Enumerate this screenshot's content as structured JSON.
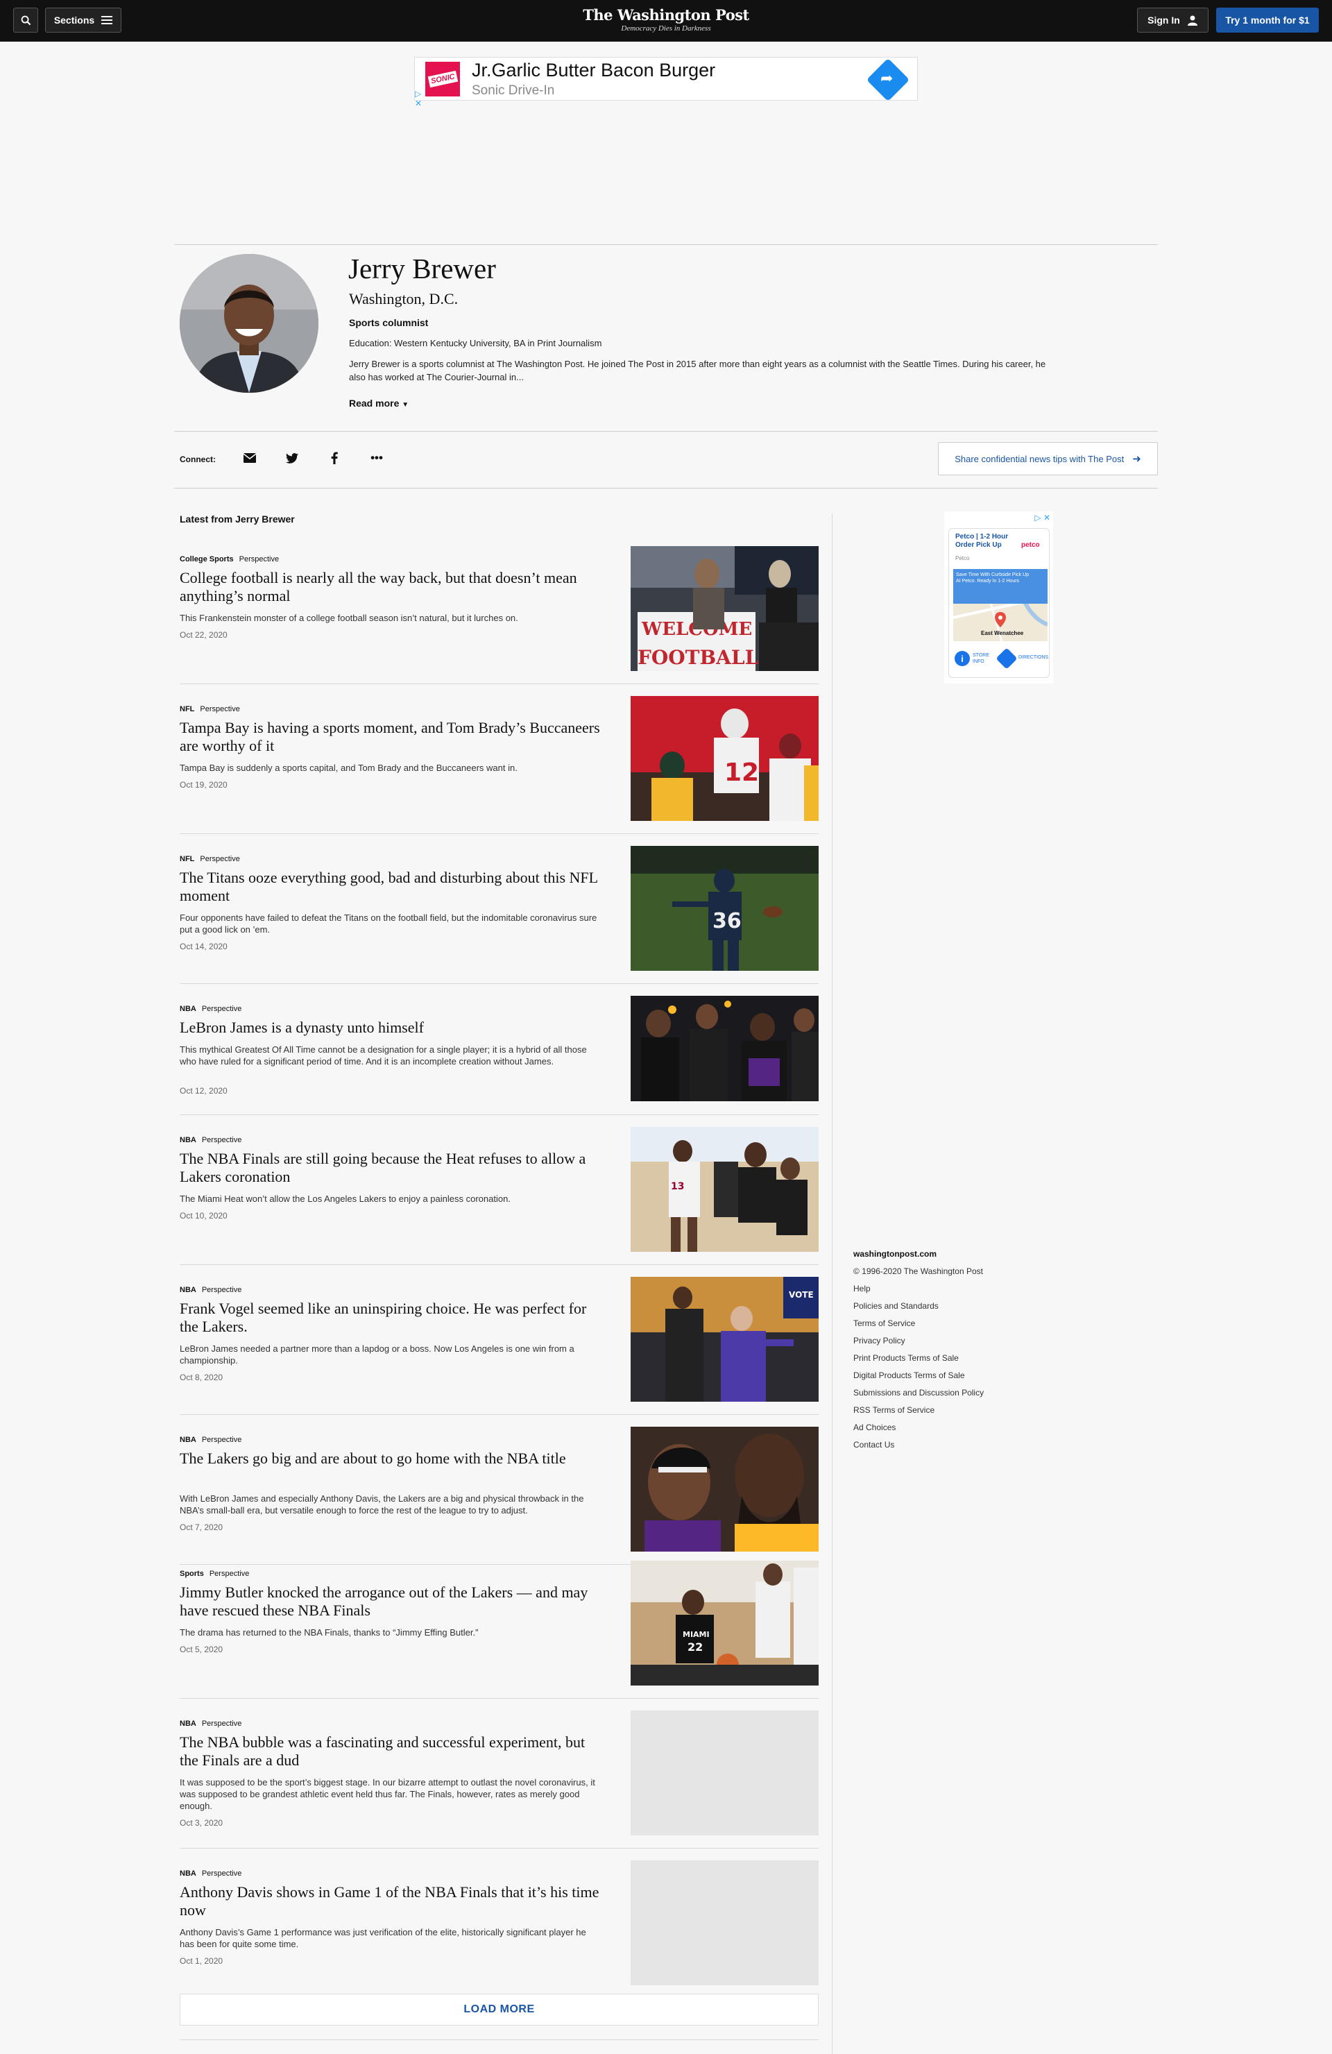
{
  "header": {
    "logo_name": "The Washington Post",
    "logo_tagline": "Democracy Dies in Darkness",
    "sections_label": "Sections",
    "signin_label": "Sign In",
    "subscribe_label": "Try 1 month for $1"
  },
  "ad_banner": {
    "brand": "SONIC",
    "title": "Jr.Garlic Butter Bacon Burger",
    "subtitle": "Sonic Drive-In"
  },
  "author": {
    "name": "Jerry Brewer",
    "location": "Washington, D.C.",
    "role": "Sports columnist",
    "education": "Education: Western Kentucky University, BA in Print Journalism",
    "bio": "Jerry Brewer is a sports columnist at The Washington Post. He joined The Post in 2015 after more than eight years as a columnist with the Seattle Times. During his career, he also has worked at The Courier-Journal in...",
    "read_more": "Read more"
  },
  "connect": {
    "label": "Connect:",
    "tips_label": "Share confidential news tips with The Post"
  },
  "latest_heading": "Latest from Jerry Brewer",
  "articles": [
    {
      "section": "College Sports",
      "type": "Perspective",
      "title": "College football is nearly all the way back, but that doesn’t mean anything’s normal",
      "blurb": "This Frankenstein monster of a college football season isn’t natural, but it lurches on.",
      "date": "Oct 22, 2020"
    },
    {
      "section": "NFL",
      "type": "Perspective",
      "title": "Tampa Bay is having a sports moment, and Tom Brady’s Buccaneers are worthy of it",
      "blurb": "Tampa Bay is suddenly a sports capital, and Tom Brady and the Buccaneers want in.",
      "date": "Oct 19, 2020"
    },
    {
      "section": "NFL",
      "type": "Perspective",
      "title": "The Titans ooze everything good, bad and disturbing about this NFL moment",
      "blurb": "Four opponents have failed to defeat the Titans on the football field, but the indomitable coronavirus sure put a good lick on ’em.",
      "date": "Oct 14, 2020"
    },
    {
      "section": "NBA",
      "type": "Perspective",
      "title": "LeBron James is a dynasty unto himself",
      "blurb": "This mythical Greatest Of All Time cannot be a designation for a single player; it is a hybrid of all those who have ruled for a significant period of time. And it is an incomplete creation without James.",
      "date": "Oct 12, 2020"
    },
    {
      "section": "NBA",
      "type": "Perspective",
      "title": "The NBA Finals are still going because the Heat refuses to allow a Lakers coronation",
      "blurb": "The Miami Heat won’t allow the Los Angeles Lakers to enjoy a painless coronation.",
      "date": "Oct 10, 2020"
    },
    {
      "section": "NBA",
      "type": "Perspective",
      "title": "Frank Vogel seemed like an uninspiring choice. He was perfect for the Lakers.",
      "blurb": "LeBron James needed a partner more than a lapdog or a boss. Now Los Angeles is one win from a championship.",
      "date": "Oct 8, 2020"
    },
    {
      "section": "NBA",
      "type": "Perspective",
      "title": "The Lakers go big and are about to go home with the NBA title",
      "blurb": "With LeBron James and especially Anthony Davis, the Lakers are a big and physical throwback in the NBA’s small-ball era, but versatile enough to force the rest of the league to try to adjust.",
      "date": "Oct 7, 2020"
    },
    {
      "section": "Sports",
      "type": "Perspective",
      "title": "Jimmy Butler knocked the arrogance out of the Lakers — and may have rescued these NBA Finals",
      "blurb": "The drama has returned to the NBA Finals, thanks to “Jimmy Effing Butler.”",
      "date": "Oct 5, 2020"
    },
    {
      "section": "NBA",
      "type": "Perspective",
      "title": "The NBA bubble was a fascinating and successful experiment, but the Finals are a dud",
      "blurb": "It was supposed to be the sport’s biggest stage. In our bizarre attempt to outlast the novel coronavirus, it was supposed to be grandest athletic event held thus far. The Finals, however, rates as merely good enough.",
      "date": "Oct 3, 2020"
    },
    {
      "section": "NBA",
      "type": "Perspective",
      "title": "Anthony Davis shows in Game 1 of the NBA Finals that it’s his time now",
      "blurb": "Anthony Davis’s Game 1 performance was just verification of the elite, historically significant player he has been for quite some time.",
      "date": "Oct 1, 2020"
    }
  ],
  "image_texts": {
    "welcome": "WELCOME",
    "football": "FOOTBALL",
    "qb_number": "12",
    "titans_number": "36",
    "heat_number": "13",
    "butler_number": "22",
    "vote": "VOTE"
  },
  "side_ad": {
    "title": "Petco | 1-2 Hour Order Pick Up",
    "brand": "Petco",
    "logo": "petco",
    "map_text": "Save Time With Curbside Pick Up At Petco. Ready In 1-2 Hours",
    "map_place": "East Wenatchee",
    "store_info": "STORE INFO",
    "directions": "DIRECTIONS"
  },
  "footer": {
    "brand": "washingtonpost.com",
    "copyright": "© 1996-2020 The Washington Post",
    "links": [
      "Help",
      "Policies and Standards",
      "Terms of Service",
      "Privacy Policy",
      "Print Products Terms of Sale",
      "Digital Products Terms of Sale",
      "Submissions and Discussion Policy",
      "RSS Terms of Service",
      "Ad Choices",
      "Contact Us"
    ]
  },
  "load_more": "LOAD MORE",
  "colors": {
    "accent": "#1955a5",
    "topbar": "#111111",
    "ad_brand": "#e4134f"
  }
}
